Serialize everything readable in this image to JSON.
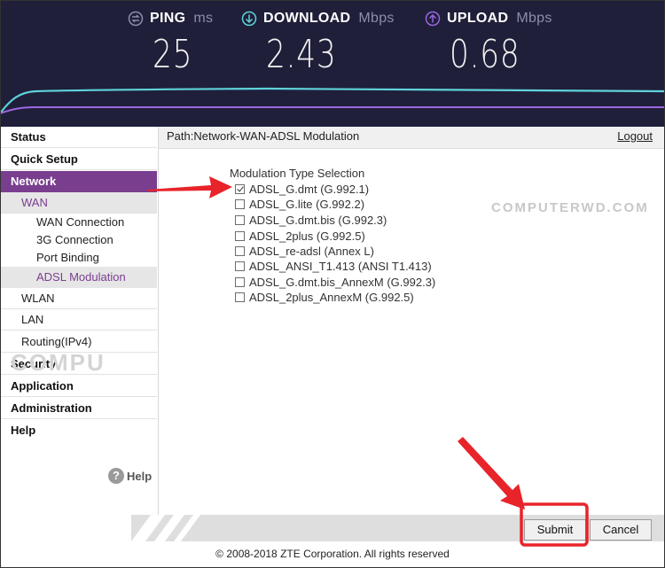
{
  "speedtest": {
    "ping": {
      "label": "PING",
      "unit": "ms",
      "value": "25"
    },
    "download": {
      "label": "DOWNLOAD",
      "unit": "Mbps",
      "value": "2.43"
    },
    "upload": {
      "label": "UPLOAD",
      "unit": "Mbps",
      "value": "0.68"
    },
    "colors": {
      "background": "#1f1f3a",
      "download": "#5fd3d9",
      "upload": "#9a67e0"
    }
  },
  "sidebar": {
    "items": [
      {
        "label": "Status"
      },
      {
        "label": "Quick Setup"
      },
      {
        "label": "Network"
      },
      {
        "label": "WAN"
      },
      {
        "label": "WAN Connection"
      },
      {
        "label": "3G Connection"
      },
      {
        "label": "Port Binding"
      },
      {
        "label": "ADSL Modulation"
      },
      {
        "label": "WLAN"
      },
      {
        "label": "LAN"
      },
      {
        "label": "Routing(IPv4)"
      },
      {
        "label": "Security"
      },
      {
        "label": "Application"
      },
      {
        "label": "Administration"
      },
      {
        "label": "Help"
      }
    ],
    "help_label": "Help",
    "accent_color": "#7a3e8f"
  },
  "header": {
    "path": "Path:Network-WAN-ADSL Modulation",
    "logout": "Logout"
  },
  "main": {
    "section_title": "Modulation Type Selection",
    "options": [
      {
        "label": "ADSL_G.dmt (G.992.1)",
        "checked": true
      },
      {
        "label": "ADSL_G.lite (G.992.2)",
        "checked": false
      },
      {
        "label": "ADSL_G.dmt.bis (G.992.3)",
        "checked": false
      },
      {
        "label": "ADSL_2plus (G.992.5)",
        "checked": false
      },
      {
        "label": "ADSL_re-adsl (Annex L)",
        "checked": false
      },
      {
        "label": "ADSL_ANSI_T1.413 (ANSI T1.413)",
        "checked": false
      },
      {
        "label": "ADSL_G.dmt.bis_AnnexM (G.992.3)",
        "checked": false
      },
      {
        "label": "ADSL_2plus_AnnexM (G.992.5)",
        "checked": false
      }
    ]
  },
  "watermarks": [
    "COMPUTERWD.COM",
    "COMPU"
  ],
  "buttons": {
    "submit": "Submit",
    "cancel": "Cancel"
  },
  "footer": {
    "copyright": "© 2008-2018 ZTE Corporation. All rights reserved"
  },
  "annotation_color": "#e8232a"
}
